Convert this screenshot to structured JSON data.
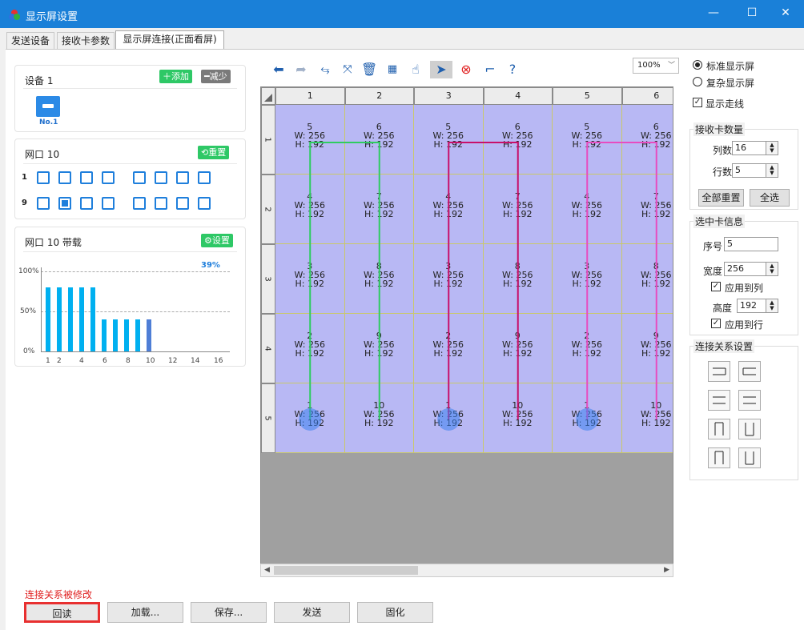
{
  "window": {
    "title": "显示屏设置",
    "min": "—",
    "max": "☐",
    "close": "✕"
  },
  "tabs": [
    "发送设备",
    "接收卡参数",
    "显示屏连接(正面看屏)"
  ],
  "device_panel": {
    "title": "设备 1",
    "add": "添加",
    "reduce": "减少",
    "device_label": "No.1"
  },
  "port_panel": {
    "title": "网口 10",
    "reset": "重置",
    "row1": "1",
    "row2": "9"
  },
  "bandwidth_panel": {
    "title": "网口 10 带载",
    "settings": "设置",
    "percent": "39%",
    "y_ticks": [
      "100%",
      "50%",
      "0%"
    ],
    "x_ticks": [
      "1",
      "2",
      "4",
      "6",
      "8",
      "10",
      "12",
      "14",
      "16"
    ]
  },
  "chart_data": {
    "type": "bar",
    "title": "网口 10 带载",
    "categories": [
      "1",
      "2",
      "3",
      "4",
      "5",
      "6",
      "7",
      "8",
      "9",
      "10"
    ],
    "values": [
      76,
      76,
      76,
      76,
      76,
      38,
      38,
      38,
      38,
      38
    ],
    "highlight_value": 39,
    "ylim": [
      0,
      100
    ]
  },
  "zoom": {
    "value": "100%"
  },
  "grid": {
    "columns": [
      "1",
      "2",
      "3",
      "4",
      "5",
      "6"
    ],
    "rows": [
      "1",
      "2",
      "3",
      "4",
      "5"
    ],
    "cell_numbers": [
      [
        "5",
        "6",
        "5",
        "6",
        "5",
        "6"
      ],
      [
        "4",
        "7",
        "4",
        "7",
        "4",
        "7"
      ],
      [
        "3",
        "8",
        "3",
        "8",
        "3",
        "8"
      ],
      [
        "2",
        "9",
        "2",
        "9",
        "2",
        "9"
      ],
      [
        "1",
        "10",
        "1",
        "10",
        "1",
        "10"
      ]
    ],
    "w_text": "W: 256",
    "h_text": "H: 192",
    "line_colors": [
      "#2ecc60",
      "#c8106a",
      "#e84cc0"
    ]
  },
  "right": {
    "std_screen": "标准显示屏",
    "complex_screen": "复杂显示屏",
    "show_route": "显示走线",
    "recv_count": "接收卡数量",
    "cols_label": "列数",
    "cols_value": "16",
    "rows_label": "行数",
    "rows_value": "5",
    "reset_all": "全部重置",
    "select_all": "全选",
    "sel_info": "选中卡信息",
    "index_label": "序号",
    "index_value": "5",
    "width_label": "宽度",
    "width_value": "256",
    "apply_col": "应用到列",
    "height_label": "高度",
    "height_value": "192",
    "apply_row": "应用到行",
    "conn_settings": "连接关系设置"
  },
  "bottom": {
    "modified_msg": "连接关系被修改",
    "readback": "回读",
    "load": "加载...",
    "save": "保存...",
    "send": "发送",
    "solidify": "固化"
  }
}
